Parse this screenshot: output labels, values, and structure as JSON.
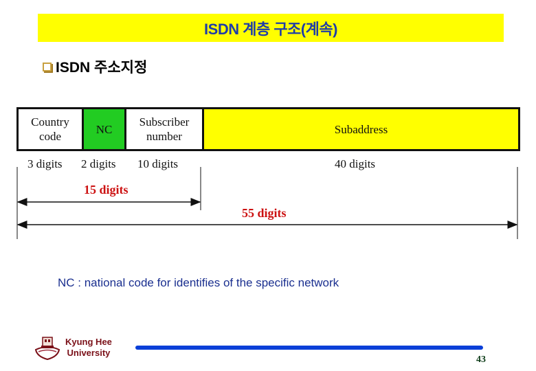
{
  "slide": {
    "title": "ISDN 계층 구조(계속)",
    "bullet": "ISDN 주소지정",
    "title_color": "#1f3da8",
    "title_bg": "#ffff00"
  },
  "diagram": {
    "segments": [
      {
        "label_line1": "Country",
        "label_line2": "code",
        "digits": "3 digits",
        "color": "#ffffff"
      },
      {
        "label_line1": "NC",
        "label_line2": "",
        "digits": "2 digits",
        "color": "#22cc22"
      },
      {
        "label_line1": "Subscriber",
        "label_line2": "number",
        "digits": "10 digits",
        "color": "#ffffff"
      },
      {
        "label_line1": "Subaddress",
        "label_line2": "",
        "digits": "40 digits",
        "color": "#ffff00"
      }
    ],
    "span_isdn_number": "15 digits",
    "span_total": "55 digits",
    "span_label_color": "#cc1111"
  },
  "note": "NC : national code for identifies of the specific network",
  "footer": {
    "university_line1": "Kyung Hee",
    "university_line2": "University",
    "page_number": "43",
    "bar_color": "#0a3fd8"
  }
}
